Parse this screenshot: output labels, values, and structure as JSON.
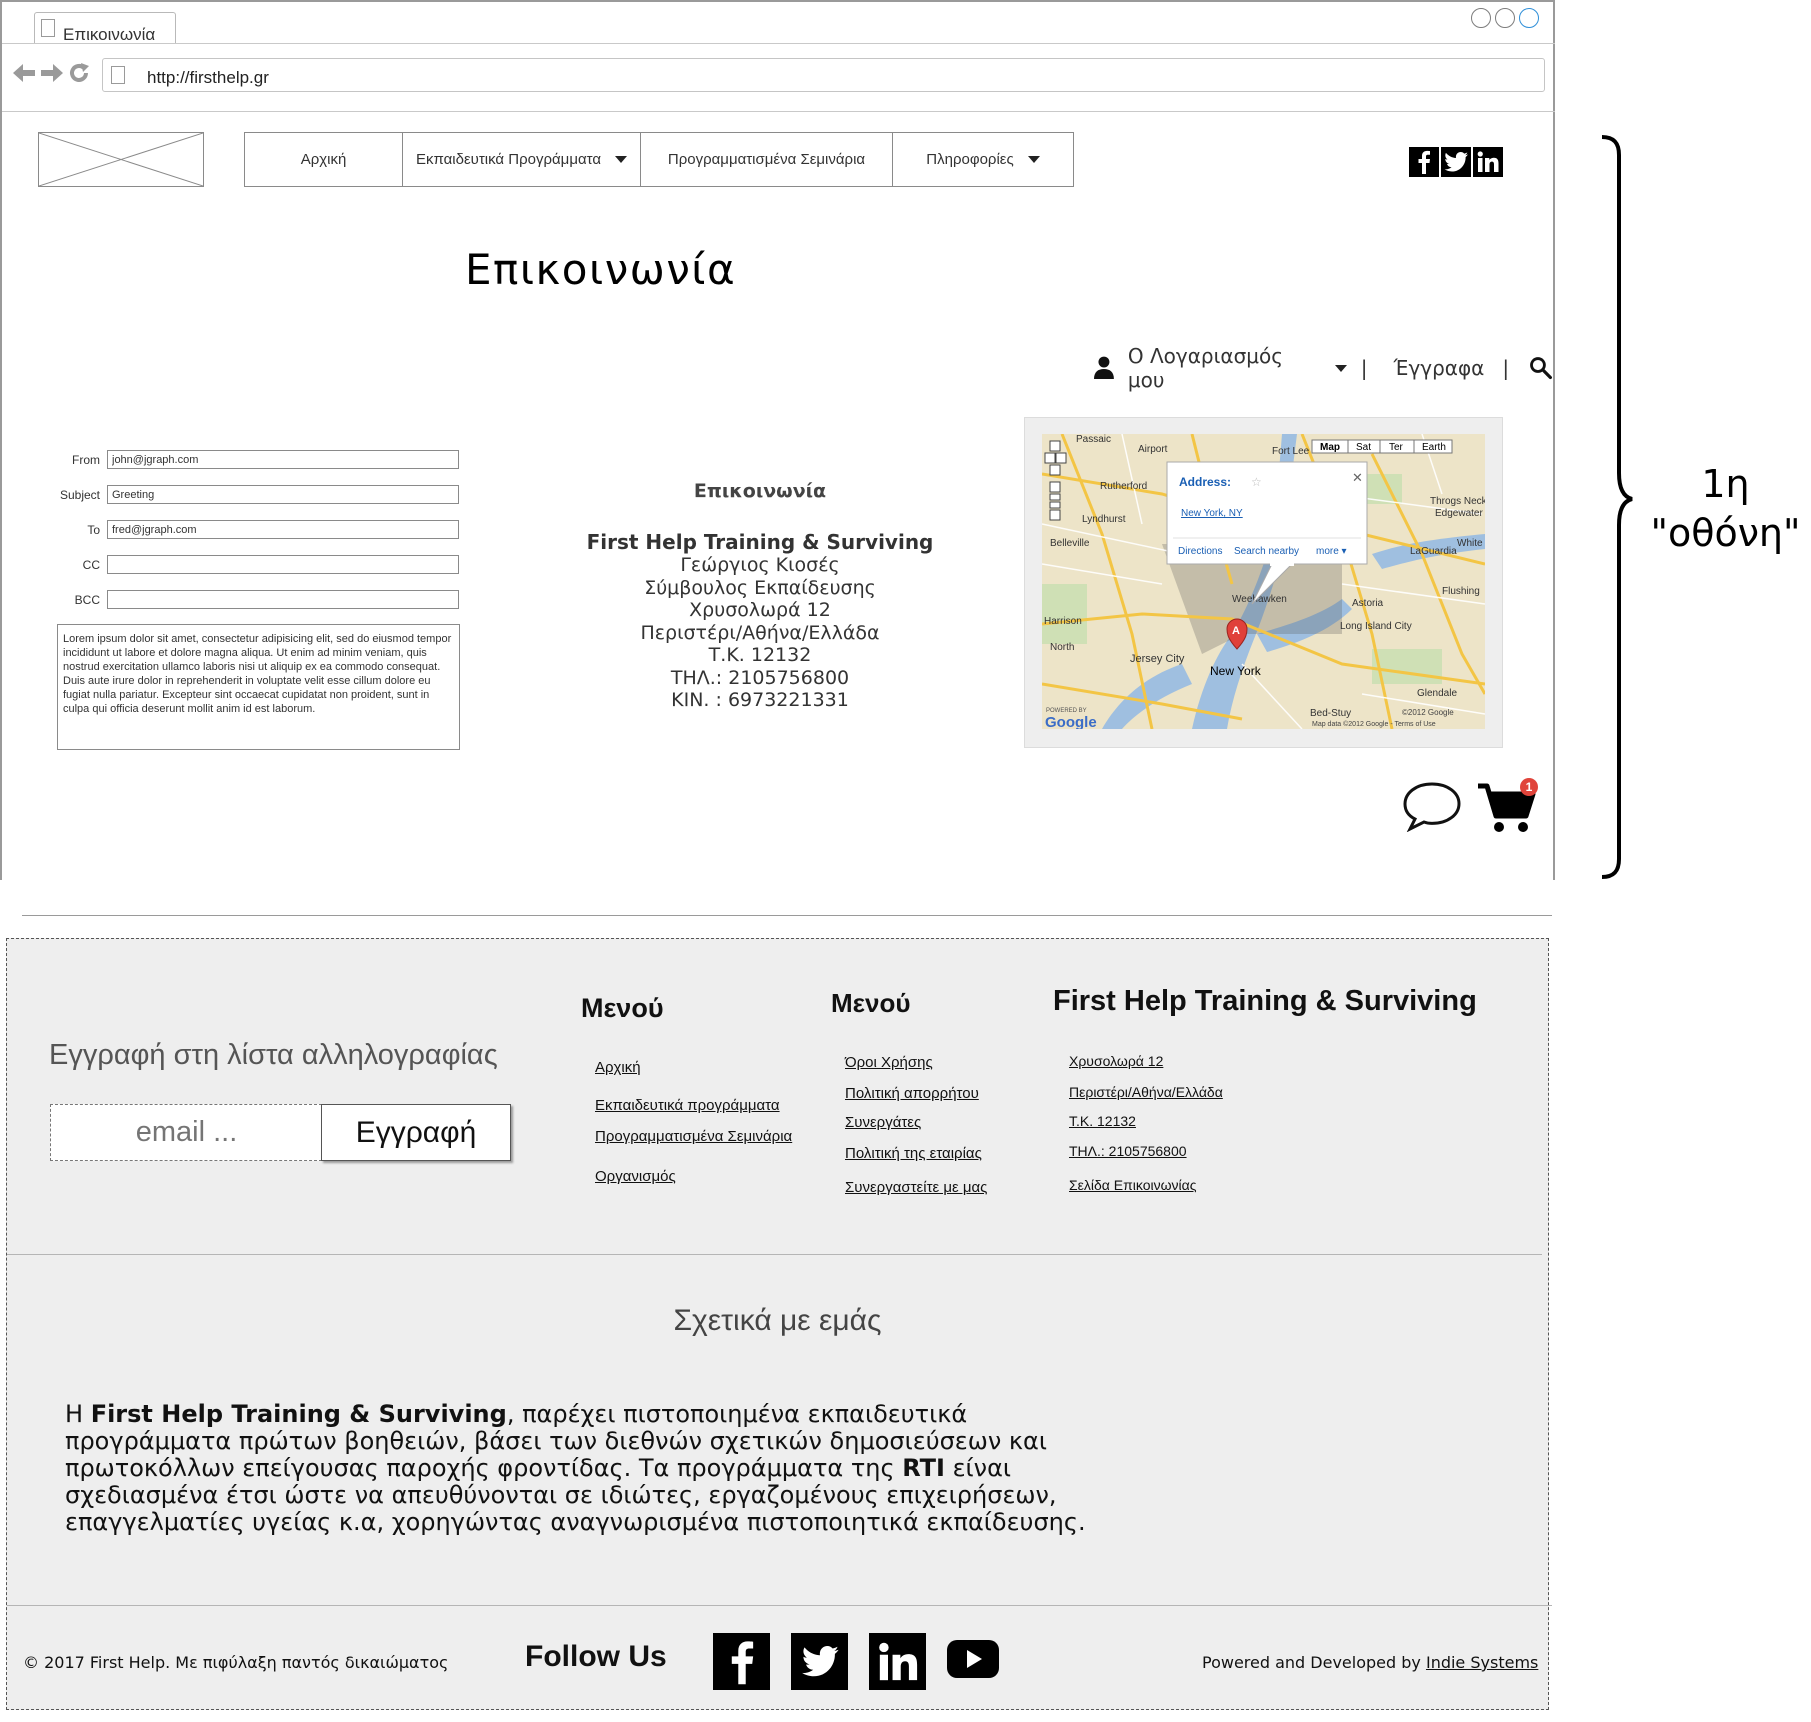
{
  "browser": {
    "tab_title": "Επικοινωνία",
    "url": "http://firsthelp.gr"
  },
  "nav": {
    "items": [
      {
        "label": "Αρχική",
        "dropdown": false
      },
      {
        "label": "Εκπαιδευτικά Προγράμματα",
        "dropdown": true
      },
      {
        "label": "Προγραμματισμένα Σεμινάρια",
        "dropdown": false
      },
      {
        "label": "Πληροφορίες",
        "dropdown": true
      }
    ],
    "social_icons": [
      "facebook-icon",
      "twitter-icon",
      "linkedin-icon"
    ]
  },
  "page": {
    "title": "Επικοινωνία"
  },
  "account_bar": {
    "account_label": "Ο Λογαριασμός μου",
    "documents_label": "Έγγραφα",
    "separator": "|"
  },
  "email_form": {
    "fields": [
      {
        "label": "From",
        "value": "john@jgraph.com"
      },
      {
        "label": "Subject",
        "value": "Greeting"
      },
      {
        "label": "To",
        "value": "fred@jgraph.com"
      },
      {
        "label": "CC",
        "value": ""
      },
      {
        "label": "BCC",
        "value": ""
      }
    ],
    "message": "Lorem ipsum dolor sit amet, consectetur adipisicing elit, sed do eiusmod tempor incididunt ut labore et dolore magna aliqua. Ut enim ad minim veniam, quis nostrud exercitation ullamco laboris nisi ut aliquip ex ea commodo consequat. Duis aute irure dolor in reprehenderit in voluptate velit esse cillum dolore eu fugiat nulla pariatur. Excepteur sint occaecat cupidatat non proident, sunt in culpa qui officia deserunt mollit anim id est laborum."
  },
  "contact": {
    "heading": "Επικοινωνία",
    "company": "First Help Training & Surviving",
    "lines": [
      "Γεώργιος Κιοσές",
      "Σύμβουλος Εκπαίδευσης",
      "Χρυσολωρά 12",
      "Περιστέρι/Αθήνα/Ελλάδα",
      "Τ.Κ. 12132",
      "ΤΗΛ.: 2105756800",
      "ΚΙΝ. : 6973221331"
    ]
  },
  "map": {
    "type_buttons": [
      "Map",
      "Sat",
      "Ter",
      "Earth"
    ],
    "popup_title": "Address:",
    "popup_link": "New York, NY",
    "popup_actions": [
      "Directions",
      "Search nearby",
      "more ▾"
    ],
    "marker_letter": "A",
    "city_label": "New York",
    "place_labels": [
      "Passaic",
      "Airport",
      "Fort Lee",
      "Rutherford",
      "Lyndhurst",
      "Belleville",
      "Jersey City",
      "Harrison",
      "Astoria",
      "Long Island City",
      "LaGuardia",
      "Glendale",
      "Throgs Neck",
      "Edgewater",
      "White",
      "Flushing",
      "Bed-Stuy",
      "North",
      "Weehawken"
    ],
    "copyright": "©2012 Google",
    "data_credit": "Map data ©2012 Google - Terms of Use",
    "logo_text": "Google",
    "logo_prefix": "POWERED BY"
  },
  "cart": {
    "badge_count": "1"
  },
  "annotation": {
    "line1": "1η",
    "line2": "\"οθόνη\""
  },
  "footer": {
    "mailing_title": "Εγγραφή στη λίστα αλληλογραφίας",
    "email_placeholder": "email ...",
    "subscribe_label": "Εγγραφή",
    "menu1": {
      "title": "Μενού",
      "links": [
        "Αρχική",
        "Εκπαιδευτικά προγράμματα",
        "Προγραμματισμένα Σεμινάρια",
        "Οργανισμός"
      ]
    },
    "menu2": {
      "title": "Μενού",
      "links": [
        "Όροι Χρήσης",
        "Πολιτική απορρήτου",
        "Συνεργάτες",
        "Πολιτική  της εταιρίας",
        "Συνεργαστείτε με μας"
      ]
    },
    "company_col": {
      "title": "First Help Training & Surviving",
      "links": [
        "Χρυσολωρά 12",
        "Περιστέρι/Αθήνα/Ελλάδα",
        "Τ.Κ. 12132",
        "ΤΗΛ.: 2105756800",
        "Σελίδα Επικοινωνίας"
      ]
    },
    "about": {
      "title": "Σχετικά με εμάς",
      "p1": "Η ",
      "company": "First Help Training & Surviving",
      "p2": ", παρέχει πιστοποιημένα εκπαιδευτικά προγράμματα πρώτων βοηθειών, βάσει των διεθνών σχετικών δημοσιεύσεων και πρωτοκόλλων επείγουσας παροχής φροντίδας. Τα προγράμματα της ",
      "rti": "RTI",
      "p3": " είναι σχεδιασμένα έτσι ώστε να απευθύνονται σε ιδιώτες, εργαζομένους επιχειρήσεων, επαγγελματίες υγείας κ.α, χορηγώντας αναγνωρισμένα πιστοποιητικά εκπαίδευσης."
    },
    "copyright": "© 2017 First Help. Με πιφύλαξη παντός δικαιώματος",
    "follow_us": "Follow Us",
    "powered_prefix": "Powered and Developed by ",
    "powered_link": "Indie Systems",
    "social_icons": [
      "facebook-icon",
      "twitter-icon",
      "linkedin-icon",
      "youtube-icon"
    ]
  }
}
